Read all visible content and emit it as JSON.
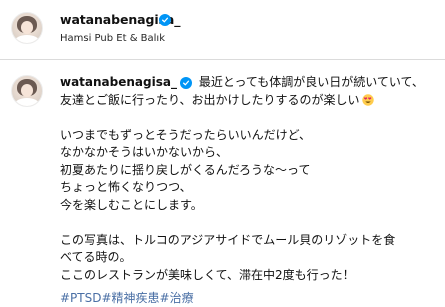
{
  "header": {
    "username": "watanabenagisa_",
    "location": "Hamsi Pub Et & Balık"
  },
  "post": {
    "username": "watanabenagisa_",
    "lines": [
      "最近とっても体調が良い日が続いていて、",
      "友達とご飯に行ったり、お出かけしたりするのが楽しい",
      "",
      "いつまでもずっとそうだったらいいんだけど、",
      "なかなかそうはいかないから、",
      "初夏あたりに揺り戻しがくるんだろうな〜って",
      "ちょっと怖くなりつつ、",
      "今を楽しむことにします。",
      "",
      "この写真は、トルコのアジアサイドでムール貝のリゾットを食",
      "べてる時の。",
      "ここのレストランが美味しくて、滞在中2度も行った！"
    ],
    "emoji": "heart-eyes-emoji",
    "hashtags": [
      "#PTSD",
      "#精神疾患",
      "#治療"
    ]
  },
  "colors": {
    "verified": "#0095f6",
    "hashtag": "#4a6fa5",
    "divider": "#dbdbdb"
  }
}
